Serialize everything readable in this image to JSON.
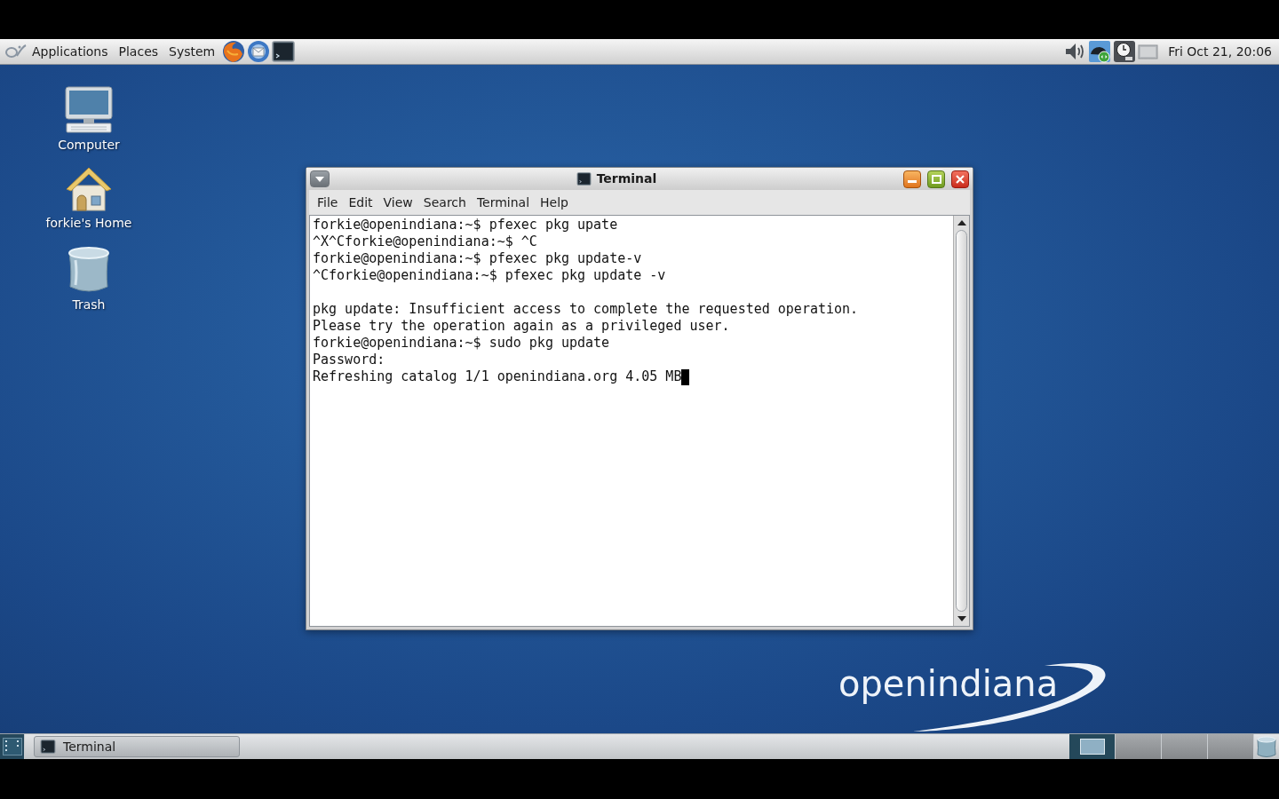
{
  "top_panel": {
    "menus": [
      "Applications",
      "Places",
      "System"
    ],
    "clock": "Fri Oct 21, 20:06"
  },
  "desktop_icons": [
    {
      "kind": "computer",
      "label": "Computer"
    },
    {
      "kind": "home",
      "label": "forkie's Home"
    },
    {
      "kind": "trash",
      "label": "Trash"
    }
  ],
  "terminal_window": {
    "title": "Terminal",
    "menu": [
      "File",
      "Edit",
      "View",
      "Search",
      "Terminal",
      "Help"
    ],
    "blocks": [
      {
        "lines": [
          "forkie@openindiana:~$ pfexec pkg upate",
          "^X^Cforkie@openindiana:~$ ^C",
          "forkie@openindiana:~$ pfexec pkg update-v",
          "^Cforkie@openindiana:~$ pfexec pkg update -v"
        ]
      },
      {
        "lines": [
          "pkg update: Insufficient access to complete the requested operation.",
          "Please try the operation again as a privileged user.",
          "forkie@openindiana:~$ sudo pkg update",
          "Password:",
          "Refreshing catalog 1/1 openindiana.org 4.05 MB"
        ]
      }
    ],
    "cursor_visible": true
  },
  "wallpaper": {
    "logo": "openindiana"
  },
  "bottom_panel": {
    "tasks": [
      {
        "label": "Terminal"
      }
    ],
    "workspaces": [
      {
        "selected": true,
        "has_window": true
      },
      {
        "selected": false,
        "has_window": false
      },
      {
        "selected": false,
        "has_window": false
      },
      {
        "selected": false,
        "has_window": false
      }
    ]
  }
}
